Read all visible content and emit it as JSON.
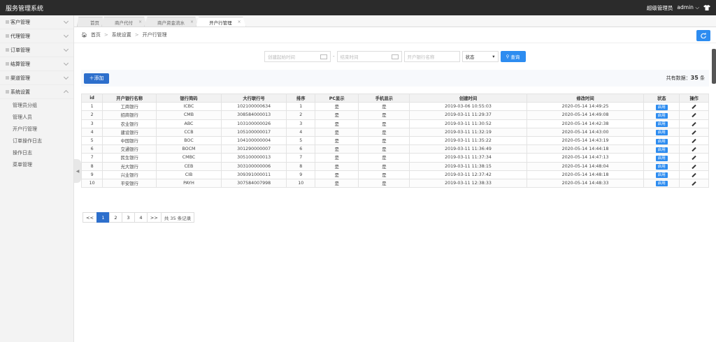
{
  "topbar": {
    "title": "服务管理系统",
    "role": "超级管理员",
    "user": "admin"
  },
  "sidebar": {
    "items": [
      {
        "label": "客户管理"
      },
      {
        "label": "代理管理"
      },
      {
        "label": "订单管理"
      },
      {
        "label": "结算管理"
      },
      {
        "label": "渠道管理"
      },
      {
        "label": "系统设置"
      }
    ],
    "sub_items": [
      "管理员分组",
      "管理人员",
      "开户行管理",
      "订单操作日志",
      "操作日志",
      "菜单管理"
    ]
  },
  "tabs": [
    "首页",
    "商户代付",
    "商户资金流水",
    "开户行管理"
  ],
  "breadcrumb": {
    "home": "首页",
    "level1": "系统设置",
    "level2": "开户行管理"
  },
  "search": {
    "start_placeholder": "创建起始时间",
    "end_placeholder": "结束时间",
    "bank_placeholder": "开户银行名称",
    "status_value": "状态",
    "query_label": "查询"
  },
  "toolbar": {
    "add_label": "添加",
    "total_prefix": "共有数据：",
    "total_count": "35",
    "total_suffix": "条"
  },
  "table": {
    "headers": [
      "id",
      "开户银行名称",
      "银行简码",
      "大行联行号",
      "排序",
      "PC显示",
      "手机显示",
      "创建时间",
      "修改时间",
      "状态",
      "操作"
    ],
    "rows": [
      [
        "1",
        "工商银行",
        "ICBC",
        "102100000634",
        "1",
        "是",
        "是",
        "2019-03-06 10:55:03",
        "2020-05-14 14:49:25",
        "启用"
      ],
      [
        "2",
        "招商银行",
        "CMB",
        "308584000013",
        "2",
        "是",
        "是",
        "2019-03-11 11:29:37",
        "2020-05-14 14:49:08",
        "启用"
      ],
      [
        "3",
        "农业银行",
        "ABC",
        "103100000026",
        "3",
        "是",
        "是",
        "2019-03-11 11:30:52",
        "2020-05-14 14:42:38",
        "启用"
      ],
      [
        "4",
        "建设银行",
        "CCB",
        "105100000017",
        "4",
        "是",
        "是",
        "2019-03-11 11:32:19",
        "2020-05-14 14:43:00",
        "启用"
      ],
      [
        "5",
        "中国银行",
        "BOC",
        "104100000004",
        "5",
        "是",
        "是",
        "2019-03-11 11:35:22",
        "2020-05-14 14:43:19",
        "启用"
      ],
      [
        "6",
        "交通银行",
        "BOCM",
        "301290000007",
        "6",
        "是",
        "是",
        "2019-03-11 11:36:49",
        "2020-05-14 14:44:18",
        "启用"
      ],
      [
        "7",
        "民生银行",
        "CMBC",
        "305100000013",
        "7",
        "是",
        "是",
        "2019-03-11 11:37:34",
        "2020-05-14 14:47:13",
        "启用"
      ],
      [
        "8",
        "光大银行",
        "CEB",
        "303100000006",
        "8",
        "是",
        "是",
        "2019-03-11 11:38:15",
        "2020-05-14 14:48:04",
        "启用"
      ],
      [
        "9",
        "兴业银行",
        "CIB",
        "309391000011",
        "9",
        "是",
        "是",
        "2019-03-11 12:37:42",
        "2020-05-14 14:48:18",
        "启用"
      ],
      [
        "10",
        "平安银行",
        "PAYH",
        "307584007998",
        "10",
        "是",
        "是",
        "2019-03-11 12:38:33",
        "2020-05-14 14:48:33",
        "启用"
      ]
    ]
  },
  "pager": {
    "prev": "<<",
    "pages": [
      "1",
      "2",
      "3",
      "4"
    ],
    "next": ">>",
    "info": "共 35 条记录"
  },
  "colors": {
    "primary": "#2d8cf0",
    "dark_primary": "#2d6fcc",
    "topbar": "#2b2b2b"
  }
}
